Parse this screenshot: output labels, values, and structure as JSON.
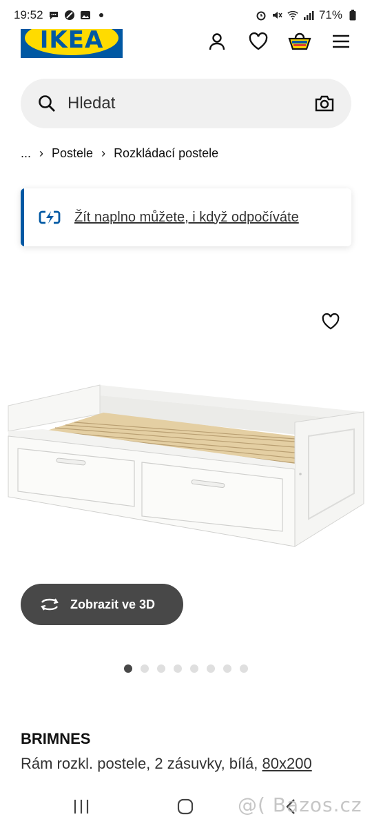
{
  "status_bar": {
    "time": "19:52",
    "battery": "71%"
  },
  "header": {
    "logo_text": "IKEA"
  },
  "search": {
    "placeholder": "Hledat"
  },
  "breadcrumb": {
    "items": [
      "...",
      "Postele",
      "Rozkládací postele"
    ]
  },
  "banner": {
    "text": "Žít naplno můžete, i když odpočíváte"
  },
  "view_3d": {
    "label": "Zobrazit ve 3D"
  },
  "carousel": {
    "total": 8,
    "active": 1
  },
  "product": {
    "name": "BRIMNES",
    "description": "Rám rozkl. postele, 2 zásuvky, bílá, ",
    "size": "80x200"
  },
  "watermark": "@( Bazos.cz",
  "colors": {
    "brand_blue": "#0058a3",
    "brand_yellow": "#ffdb00",
    "button_dark": "#484848"
  }
}
